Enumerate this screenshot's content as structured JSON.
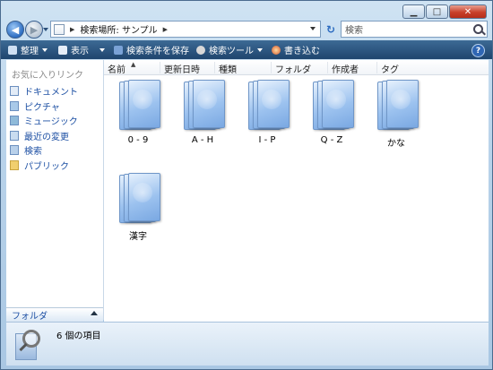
{
  "address": {
    "path_label": "検索場所: サンプル"
  },
  "search": {
    "placeholder": "検索"
  },
  "toolbar": {
    "organize": "整理",
    "views": "表示",
    "save_search": "検索条件を保存",
    "search_tools": "検索ツール",
    "burn": "書き込む"
  },
  "nav": {
    "favorites_title": "お気に入りリンク",
    "items": [
      {
        "label": "ドキュメント",
        "icon": "documents-icon"
      },
      {
        "label": "ピクチャ",
        "icon": "pictures-icon"
      },
      {
        "label": "ミュージック",
        "icon": "music-icon"
      },
      {
        "label": "最近の変更",
        "icon": "recent-changes-icon"
      },
      {
        "label": "検索",
        "icon": "searches-icon"
      },
      {
        "label": "パブリック",
        "icon": "public-folder-icon"
      }
    ],
    "folders_label": "フォルダ"
  },
  "columns": [
    "名前",
    "更新日時",
    "種類",
    "フォルダ",
    "作成者",
    "タグ"
  ],
  "items": [
    {
      "label": "0 - 9"
    },
    {
      "label": "A - H"
    },
    {
      "label": "I - P"
    },
    {
      "label": "Q - Z"
    },
    {
      "label": "かな"
    },
    {
      "label": "漢字"
    }
  ],
  "status": {
    "count_text": "6 個の項目"
  },
  "colors": {
    "accent": "#1c4fa3",
    "toolbar": "#2b547f",
    "close": "#c8402a"
  }
}
